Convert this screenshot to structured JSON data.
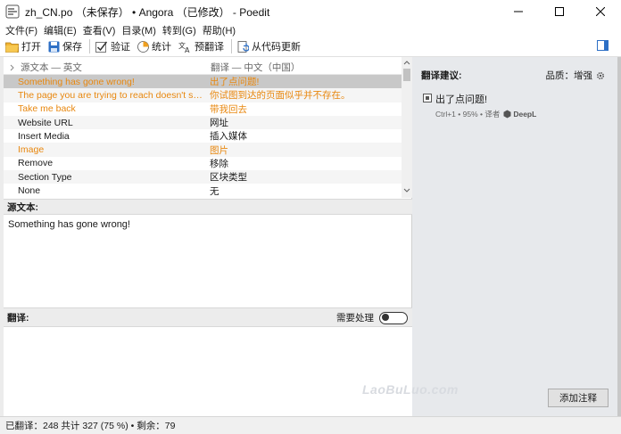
{
  "window": {
    "title": "zh_CN.po （未保存） • Angora （已修改） - Poedit"
  },
  "menu": {
    "items": [
      "文件(F)",
      "编辑(E)",
      "查看(V)",
      "目录(M)",
      "转到(G)",
      "帮助(H)"
    ]
  },
  "toolbar": {
    "open": "打开",
    "save": "保存",
    "validate": "验证",
    "stats": "统计",
    "pretranslate": "预翻译",
    "update_from_code": "从代码更新"
  },
  "list": {
    "source_header": "源文本 — 英文",
    "translation_header": "翻译 — 中文（中国）",
    "rows": [
      {
        "source": "Something has gone wrong!",
        "translation": "出了点问题!",
        "state": "fuzzy-selected"
      },
      {
        "source": "The page you are trying to reach doesn't seem...",
        "translation": "你试图到达的页面似乎并不存在。",
        "state": "fuzzy"
      },
      {
        "source": "Take me back",
        "translation": "带我回去",
        "state": "fuzzy"
      },
      {
        "source": "Website URL",
        "translation": "网址",
        "state": "normal"
      },
      {
        "source": "Insert Media",
        "translation": "插入媒体",
        "state": "normal"
      },
      {
        "source": "Image",
        "translation": "图片",
        "state": "fuzzy"
      },
      {
        "source": "Remove",
        "translation": "移除",
        "state": "normal"
      },
      {
        "source": "Section Type",
        "translation": "区块类型",
        "state": "normal"
      },
      {
        "source": "None",
        "translation": "无",
        "state": "normal"
      }
    ]
  },
  "source_panel": {
    "label": "源文本:",
    "text": "Something has gone wrong!"
  },
  "translation_panel": {
    "label": "翻译:",
    "needs_work": "需要处理",
    "needs_work_on": false
  },
  "suggestions": {
    "title": "翻译建议:",
    "quality": "品质：增强",
    "items": [
      {
        "text": "出了点问题!",
        "meta": "Ctrl+1 • 95% • 译者",
        "provider": "DeepL"
      }
    ]
  },
  "watermark": "LaoBuLuo.com",
  "add_note": "添加注释",
  "status": "已翻译：248 共计 327 (75 %) • 剩余：79",
  "colors": {
    "fuzzy": "#e8870e",
    "selected_row": "#c8c8c8",
    "right_pane": "#e7e9ec"
  }
}
